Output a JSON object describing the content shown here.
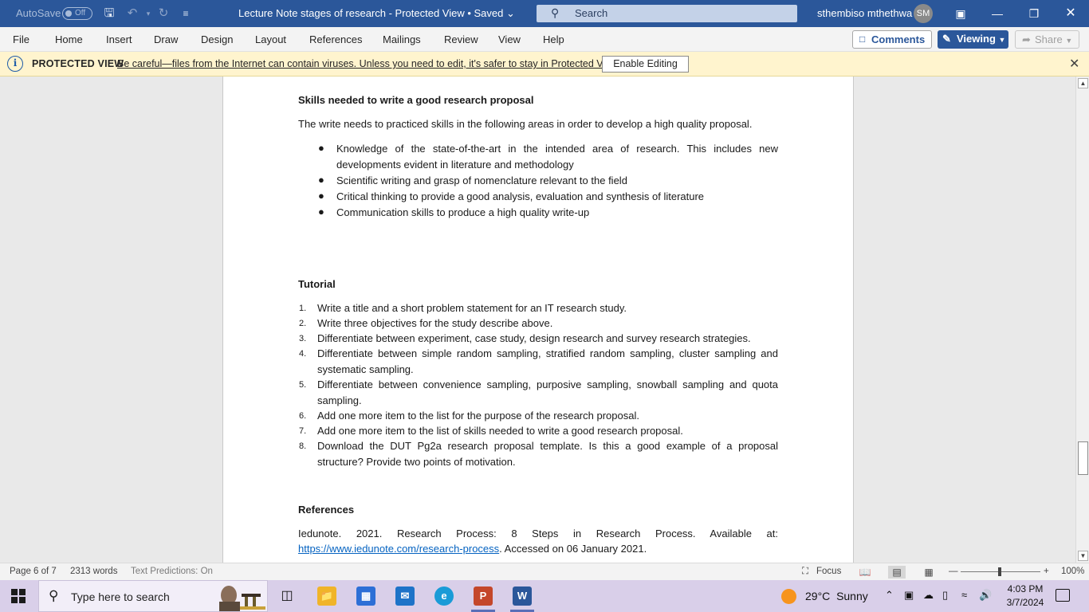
{
  "titlebar": {
    "autosave_label": "AutoSave",
    "autosave_state": "Off",
    "doc_title": "Lecture Note stages of research  -  Protected View  •  Saved",
    "search_placeholder": "Search",
    "user_name": "sthembiso mthethwa",
    "user_initials": "SM"
  },
  "menu": {
    "items": [
      "File",
      "Home",
      "Insert",
      "Draw",
      "Design",
      "Layout",
      "References",
      "Mailings",
      "Review",
      "View",
      "Help"
    ],
    "comments_label": "Comments",
    "viewing_label": "Viewing",
    "share_label": "Share"
  },
  "protected": {
    "label": "PROTECTED VIEW",
    "message": "Be careful—files from the Internet can contain viruses. Unless you need to edit, it's safer to stay in Protected View.",
    "button": "Enable Editing"
  },
  "document": {
    "skills_heading": "Skills needed to write a good research proposal",
    "skills_intro": "The write needs to practiced skills in the following areas in order to develop a high quality proposal.",
    "skills_bullets": [
      [
        "Knowledge of the state-of-the-art in the intended area of research. This includes new",
        "developments evident in literature and methodology"
      ],
      [
        "Scientific writing and grasp of nomenclature relevant to the field"
      ],
      [
        "Critical thinking to provide a good analysis, evaluation and synthesis of literature"
      ],
      [
        "Communication skills to produce a high quality write-up"
      ]
    ],
    "tutorial_heading": "Tutorial",
    "tutorial_items": [
      {
        "num": "1.",
        "lines": [
          "Write a title and a short problem statement for an IT research study."
        ]
      },
      {
        "num": "2.",
        "lines": [
          "Write three objectives for the study describe above."
        ]
      },
      {
        "num": "3.",
        "lines": [
          "Differentiate between experiment, case study, design research and survey research strategies."
        ]
      },
      {
        "num": "4.",
        "lines": [
          "Differentiate between simple random sampling, stratified random sampling, cluster sampling and",
          "systematic sampling."
        ]
      },
      {
        "num": "5.",
        "lines": [
          "Differentiate between convenience sampling, purposive sampling, snowball sampling and quota",
          "sampling."
        ]
      },
      {
        "num": "6.",
        "lines": [
          "Add one more item to the list for the purpose of the research proposal."
        ]
      },
      {
        "num": "7.",
        "lines": [
          "Add one more item to the list of skills needed to write a good research proposal."
        ]
      },
      {
        "num": "8.",
        "lines": [
          "Download the DUT Pg2a research proposal template. Is this a good example of a proposal",
          "structure? Provide two points of motivation."
        ]
      }
    ],
    "references_heading": "References",
    "reference_line1": "Iedunote. 2021. Research Process: 8 Steps in Research Process. Available at:",
    "reference_link": "https://www.iedunote.com/research-process",
    "reference_tail": ". Accessed on 06 January 2021."
  },
  "statusbar": {
    "page": "Page 6 of 7",
    "words": "2313 words",
    "text_predictions": "Text Predictions: On",
    "focus": "Focus",
    "zoom": "100%"
  },
  "taskbar": {
    "search_placeholder": "Type here to search",
    "weather_temp": "29°C",
    "weather_cond": "Sunny",
    "time": "4:03 PM",
    "date": "3/7/2024"
  }
}
